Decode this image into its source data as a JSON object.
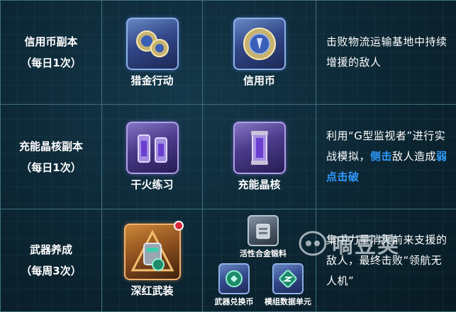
{
  "rows": [
    {
      "name": "信用币副本",
      "freq": "（每日1次）",
      "item_a": "猎金行动",
      "item_b": "信用币",
      "desc": "击败物流运输基地中持续增援的敌人"
    },
    {
      "name": "充能晶核副本",
      "freq": "（每日1次）",
      "item_a": "干火练习",
      "item_b": "充能晶核",
      "desc_parts": [
        "利用“G型监视者”进行实战模拟，",
        "侧击",
        "敌人造成",
        "弱点击破"
      ]
    },
    {
      "name": "武器养成",
      "freq": "（每周3次）",
      "item_a": "深红武装",
      "rewards": [
        "活性合金锻料",
        "武器兑换币",
        "模组数据单元"
      ],
      "desc": "集中力量消灭前来支援的敌人，最终击败“领航无人机”"
    }
  ],
  "watermark": "嘀豆荚",
  "colors": {
    "highlight": "#2f9bff",
    "border": "#3f6f7e",
    "background": "#0b2330"
  }
}
